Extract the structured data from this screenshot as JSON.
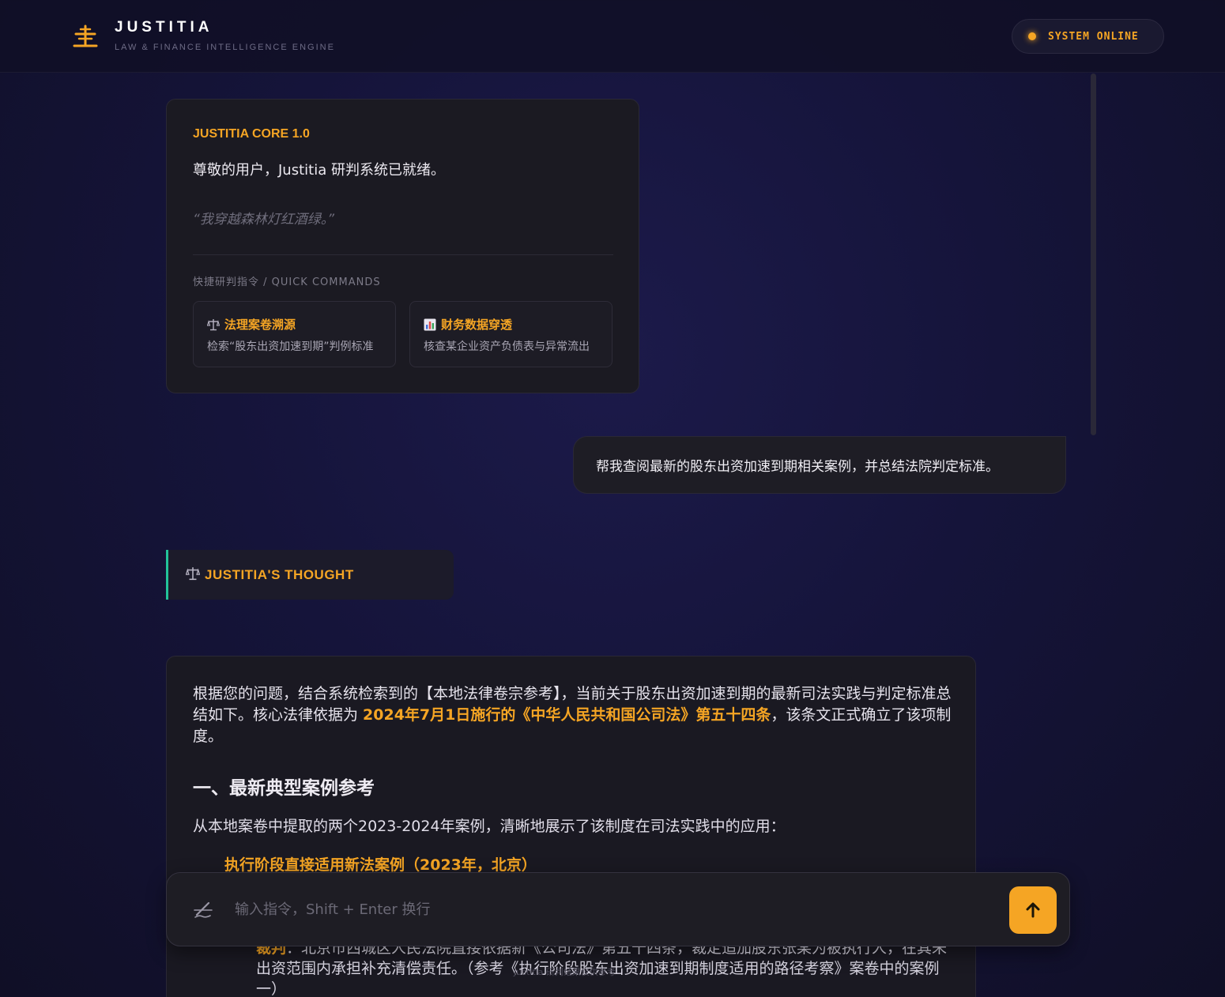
{
  "header": {
    "brand": "JUSTITIA",
    "tagline": "LAW & FINANCE INTELLIGENCE ENGINE",
    "status": "SYSTEM ONLINE",
    "logo_icon": "scale-icon",
    "accent_color": "#f5a524"
  },
  "welcome": {
    "core_label": "JUSTITIA CORE 1.0",
    "greeting": "尊敬的用户，Justitia 研判系统已就绪。",
    "quote": "“我穿越森林灯红酒绿。”",
    "quick_commands_label": "快捷研判指令 / QUICK COMMANDS",
    "quick_commands": [
      {
        "icon": "scale-icon",
        "title": "法理案卷溯源",
        "desc": "检索“股东出资加速到期”判例标准"
      },
      {
        "icon": "bar-chart-icon",
        "title": "财务数据穿透",
        "desc": "核查某企业资产负债表与异常流出"
      }
    ]
  },
  "user_message": "帮我查阅最新的股东出资加速到期相关案例，并总结法院判定标准。",
  "thought": {
    "icon": "scale-icon",
    "label": "JUSTITIA'S THOUGHT",
    "accent": "#22c39a"
  },
  "answer": {
    "intro_before": "根据您的问题，结合系统检索到的【本地法律卷宗参考】，当前关于股东出资加速到期的最新司法实践与判定标准总结如下。核心法律依据为 ",
    "intro_highlight": "2024年7月1日施行的《中华人民共和国公司法》第五十四条",
    "intro_after": "，该条文正式确立了该项制度。",
    "section_heading": "一、最新典型案例参考",
    "section_para": "从本地案卷中提取的两个2023-2024年案例，清晰地展示了该制度在司法实践中的应用：",
    "case_title": "执行阶段直接适用新法案例（2023年，北京）",
    "case_label": "裁判",
    "case_text": "：北京市西城区人民法院直接依据新《公司法》第五十四条，裁定追加股东张某为被执行人，在其未出资范围内承担补充清偿责任。（参考《执行阶段股东出资加速到期制度适用的路径考察》案卷中的案例一）"
  },
  "input": {
    "placeholder": "输入指令，Shift + Enter 换行",
    "value": "",
    "left_icon": "pen-icon",
    "send_icon": "arrow-up-icon"
  },
  "footer_watermark": "Justitia 研判结果仅供参考"
}
